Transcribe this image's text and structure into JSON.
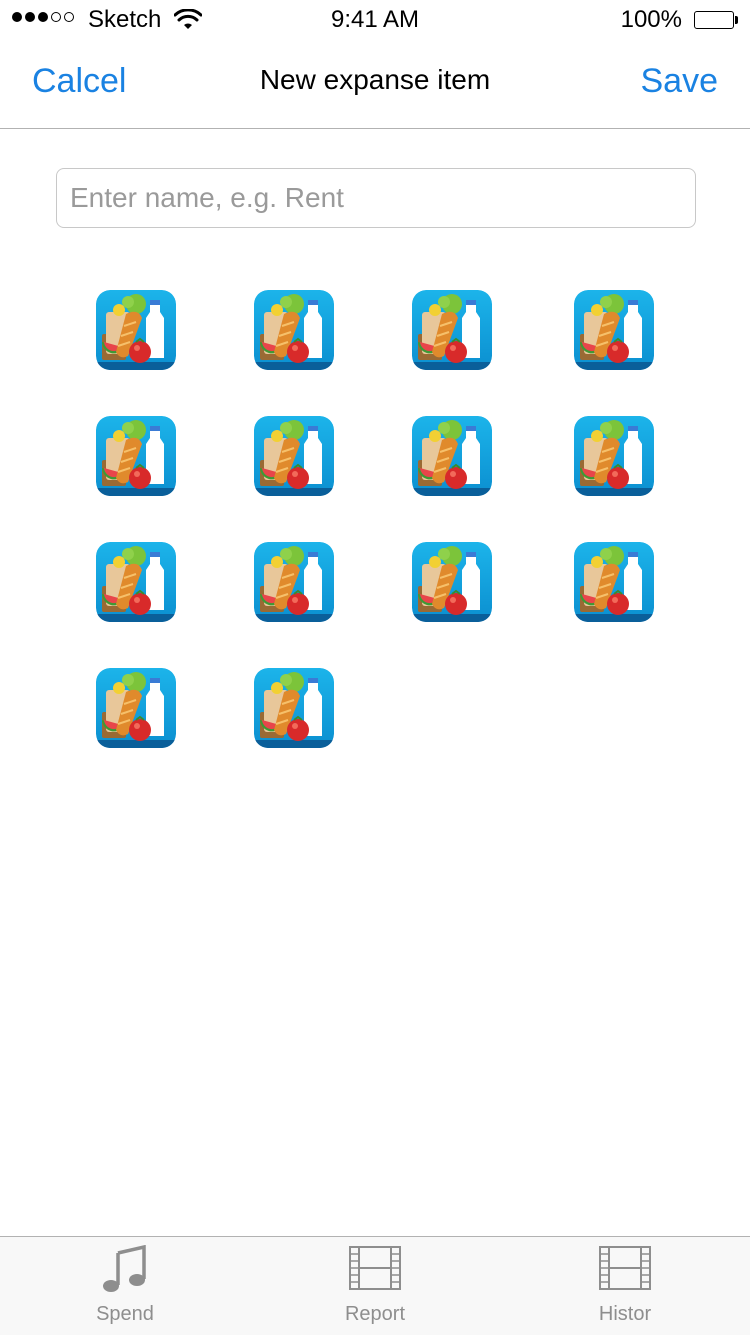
{
  "status_bar": {
    "carrier": "Sketch",
    "time": "9:41 AM",
    "battery": "100%",
    "signal_bars_filled": 3,
    "signal_bars_total": 5
  },
  "nav": {
    "cancel_label": "Calcel",
    "title": "New expanse item",
    "save_label": "Save"
  },
  "form": {
    "name_placeholder": "Enter name, e.g. Rent",
    "name_value": ""
  },
  "icon_grid": {
    "icon_name": "grocery-icon",
    "count": 14,
    "columns": 4
  },
  "tabs": [
    {
      "label": "Spend",
      "icon": "music-note-icon"
    },
    {
      "label": "Report",
      "icon": "film-icon"
    },
    {
      "label": "Histor",
      "icon": "film-icon"
    }
  ],
  "colors": {
    "accent": "#1a82e2",
    "tab_inactive": "#8e8e8e",
    "icon_background": "#16a6df"
  }
}
